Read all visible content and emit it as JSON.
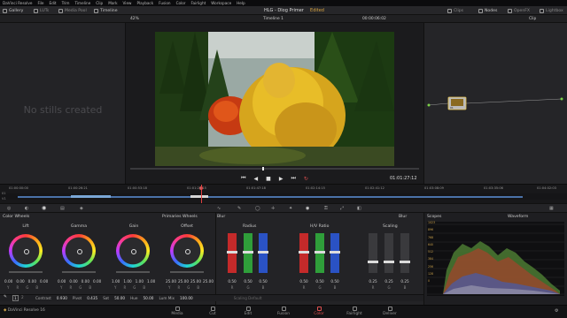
{
  "menubar": {
    "items": [
      "DaVinci Resolve",
      "File",
      "Edit",
      "Trim",
      "Timeline",
      "Clip",
      "Mark",
      "View",
      "Playback",
      "Fusion",
      "Color",
      "Fairlight",
      "Workspace",
      "Help"
    ]
  },
  "toolbar": {
    "gallery": "Gallery",
    "luts": "LUTs",
    "media_pool": "Media Pool",
    "timeline": "Timeline",
    "project_title": "HLG - Dlog Primer",
    "edited": "Edited",
    "clips": "Clips",
    "nodes": "Nodes",
    "openfx": "OpenFX",
    "lightbox": "Lightbox"
  },
  "viewer": {
    "zoom": "42%",
    "timeline_name": "Timeline 1",
    "timecode_top": "00:00:06:02",
    "clip_mode": "Clip",
    "timecode": "01:01:27:12"
  },
  "gallery": {
    "empty_text": "No stills created"
  },
  "timeline": {
    "ruler": [
      "01:00:00:00",
      "01:00:26:21",
      "01:00:53:18",
      "01:01:20:15",
      "01:01:47:18",
      "01:02:14:15",
      "01:02:41:12",
      "01:03:08:09",
      "01:03:35:06",
      "01:04:02:03"
    ],
    "track_a": "01",
    "track_b": "V1"
  },
  "color_wheels": {
    "title": "Color Wheels",
    "mode": "Primaries Wheels",
    "wheels": [
      {
        "label": "Lift",
        "values": [
          "0.00",
          "0.00",
          "0.00",
          "0.00"
        ]
      },
      {
        "label": "Gamma",
        "values": [
          "0.00",
          "0.00",
          "0.00",
          "0.00"
        ]
      },
      {
        "label": "Gain",
        "values": [
          "1.00",
          "1.00",
          "1.00",
          "1.00"
        ]
      },
      {
        "label": "Offset",
        "values": [
          "25.00",
          "25.00",
          "25.00",
          "25.00"
        ]
      }
    ],
    "channel_letters": [
      "Y",
      "R",
      "G",
      "B"
    ]
  },
  "blur": {
    "title": "Blur",
    "mode": "Blur",
    "groups": [
      {
        "label": "Radius",
        "values": [
          "0.50",
          "0.50",
          "0.50"
        ]
      },
      {
        "label": "H/V Ratio",
        "values": [
          "0.50",
          "0.50",
          "0.50"
        ]
      },
      {
        "label": "Scaling",
        "values": [
          "0.25",
          "0.25",
          "0.25"
        ]
      }
    ],
    "channel_letters": [
      "R",
      "G",
      "B"
    ]
  },
  "adjust": {
    "contrast_label": "Contrast",
    "contrast": "0.930",
    "pivot_label": "Pivot",
    "pivot": "0.435",
    "sat_label": "Sat",
    "sat": "50.00",
    "hue_label": "Hue",
    "hue": "50.00",
    "lum_label": "Lum Mix",
    "lum": "100.00",
    "page": "1",
    "page2": "2",
    "scope_mode": "Scaling Default"
  },
  "scopes": {
    "title": "Scopes",
    "type": "Waveform",
    "scale": [
      "1023",
      "896",
      "768",
      "640",
      "512",
      "384",
      "256",
      "128",
      "0"
    ]
  },
  "pages": [
    "Media",
    "Cut",
    "Edit",
    "Fusion",
    "Color",
    "Fairlight",
    "Deliver"
  ],
  "app_name": "DaVinci Resolve 16",
  "active_page": "Color"
}
